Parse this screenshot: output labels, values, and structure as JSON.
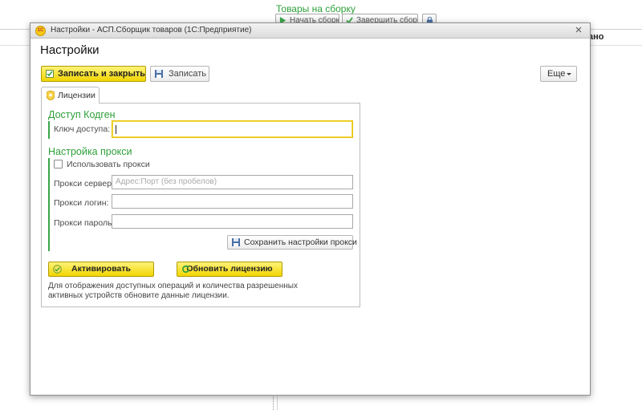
{
  "background": {
    "section_title": "Товары на сборку",
    "start_button": "Начать сборку",
    "finish_button": "Завершить сборку",
    "clipped_header": "ано"
  },
  "window": {
    "title": "Настройки - АСП.Сборщик товаров  (1С:Предприятие)",
    "logo_text": "1С",
    "close_glyph": "×"
  },
  "form": {
    "title": "Настройки",
    "toolbar": {
      "save_close_label": "Записать и закрыть",
      "save_label": "Записать",
      "more_label": "Еще"
    },
    "tab": {
      "label": "Лицензии"
    },
    "access": {
      "title": "Доступ Кодген",
      "key_label": "Ключ доступа:",
      "key_value": ""
    },
    "proxy": {
      "title": "Настройка прокси",
      "use_proxy_label": "Использовать прокси",
      "use_proxy_checked": false,
      "server_label": "Прокси сервер:",
      "server_placeholder": "Адрес:Порт (без пробелов)",
      "login_label": "Прокси логин:",
      "password_label": "Прокси пароль:",
      "save_proxy_label": "Сохранить настройки прокси"
    },
    "activate_label": "Активировать",
    "update_license_label": "Обновить лицензию",
    "info_text": "Для отображения доступных операций и количества разрешенных активных устройств обновите данные лицензии."
  },
  "colors": {
    "accent_green": "#2e9f3a",
    "primary_yellow": "#f1d500",
    "focus_yellow": "#e8c200"
  },
  "icons": [
    "check-icon",
    "floppy-icon",
    "license-icon",
    "activate-icon",
    "refresh-icon",
    "lock-icon",
    "app-logo"
  ]
}
